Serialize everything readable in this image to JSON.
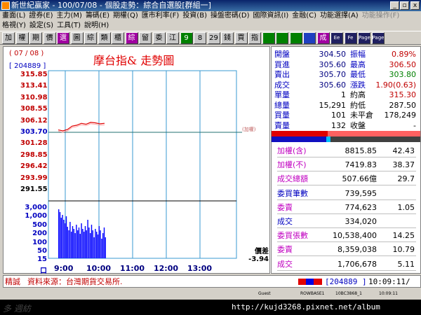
{
  "window": {
    "title": "新世紀贏家 - 100/07/08 - 個股走勢：綜合自選股[群組一]",
    "minimize": "_",
    "restore": "▫",
    "close": "x"
  },
  "menu": {
    "row1": [
      "畫面(L)",
      "證券(E)",
      "主力(M)",
      "籌碼(E)",
      "期權(Q)",
      "匯市利率(F)",
      "投資(B)",
      "操盤密碼(D)",
      "國際資訊(I)",
      "金融(C)",
      "功能選擇(A)",
      "功能操作(F)"
    ],
    "row2": [
      "格視(Y)",
      "設定(S)",
      "工具(T)",
      "說明(H)"
    ]
  },
  "toolbar": {
    "buttons": [
      "加",
      "權",
      "期",
      "價",
      "選",
      "圖",
      "綜",
      "類",
      "櫃",
      "綜",
      "留",
      "委",
      "江",
      "9",
      "8",
      "29",
      "錢",
      "買",
      "指",
      "",
      "",
      "",
      "",
      "成",
      "Ee",
      "Fe",
      "Page",
      "Page"
    ]
  },
  "chart": {
    "date": "( 07 / 08 )",
    "code": "[ 204889 ]",
    "title": "摩台指&  走勢圖",
    "y_labels": [
      "315.85",
      "313.41",
      "310.98",
      "308.55",
      "306.12",
      "303.70",
      "301.28",
      "298.85",
      "296.42",
      "293.99",
      "291.55"
    ],
    "vol_labels": [
      "3,000",
      "1,000",
      "500",
      "200",
      "100",
      "50",
      "15",
      "口"
    ],
    "x_labels": [
      "9:00",
      "10:00",
      "11:00",
      "12:00",
      "13:00"
    ],
    "ref_line_label": "(加權)",
    "diff_title": "價差",
    "diff_value": "-3.94",
    "colors": {
      "price": "#e00000",
      "volume": "#0000ff",
      "grid": "#3a9ad0",
      "ref": "#207070"
    }
  },
  "chart_data": {
    "type": "line",
    "title": "摩台指&  走勢圖",
    "x": [
      "9:00",
      "10:00",
      "11:00",
      "12:00",
      "13:00"
    ],
    "ylim": [
      291.55,
      315.85
    ],
    "series": [
      {
        "values": [
          304.2,
          304.0,
          304.3,
          305.0,
          305.2,
          305.6,
          305.4,
          305.8,
          305.7,
          305.5,
          305.6
        ]
      }
    ]
  },
  "quote": {
    "rows": [
      {
        "l1": "開盤",
        "v1": "304.50",
        "l2": "振幅",
        "v2": "0.89%"
      },
      {
        "l1": "買進",
        "v1": "305.60",
        "l2": "最高",
        "v2": "306.50"
      },
      {
        "l1": "賣出",
        "v1": "305.70",
        "l2": "最低",
        "v2": "303.80"
      },
      {
        "l1": "成交",
        "v1": "305.60",
        "l2": "漲跌",
        "v2": "1.90(0.63)"
      },
      {
        "l1": "單量",
        "v1": "1",
        "l2": "約高",
        "v2": "315.30"
      },
      {
        "l1": "總量",
        "v1": "15,291",
        "l2": "約低",
        "v2": "287.50"
      },
      {
        "l1": "買量",
        "v1": "101",
        "l2": "未平倉",
        "v2": "178,249"
      },
      {
        "l1": "賣量",
        "v1": "132",
        "l2": "收盤",
        "v2": "-"
      }
    ],
    "bottom": [
      {
        "label": "加權(含)",
        "a": "8815.85",
        "b": "42.43"
      },
      {
        "label": "加權(不)",
        "a": "7419.83",
        "b": "38.37"
      },
      {
        "label": "成交總額",
        "a": "507.66億",
        "b": "29.7"
      },
      {
        "label": "委買筆數",
        "a": "739,595",
        "b": ""
      },
      {
        "label": "委賣",
        "a": "774,623",
        "b": "1.05"
      },
      {
        "label": "成交",
        "a": "334,020",
        "b": ""
      },
      {
        "label": "委買張數",
        "a": "10,538,400",
        "b": "14.25"
      },
      {
        "label": "委賣",
        "a": "8,359,038",
        "b": "10.79"
      },
      {
        "label": "成交",
        "a": "1,706,678",
        "b": "5.11"
      }
    ]
  },
  "footer": {
    "tag": "精誠",
    "source": "資料來源：台灣期貨交易所.",
    "code": "[204889 ]",
    "time": "10:09:11/"
  },
  "status": {
    "user": "Guest",
    "host": "ROWBASE1",
    "id": "10BC3868_1",
    "clock": "10:09:11"
  },
  "taskbar": {
    "logo": "多 週紡",
    "url": "http://kujd3268.pixnet.net/album"
  }
}
